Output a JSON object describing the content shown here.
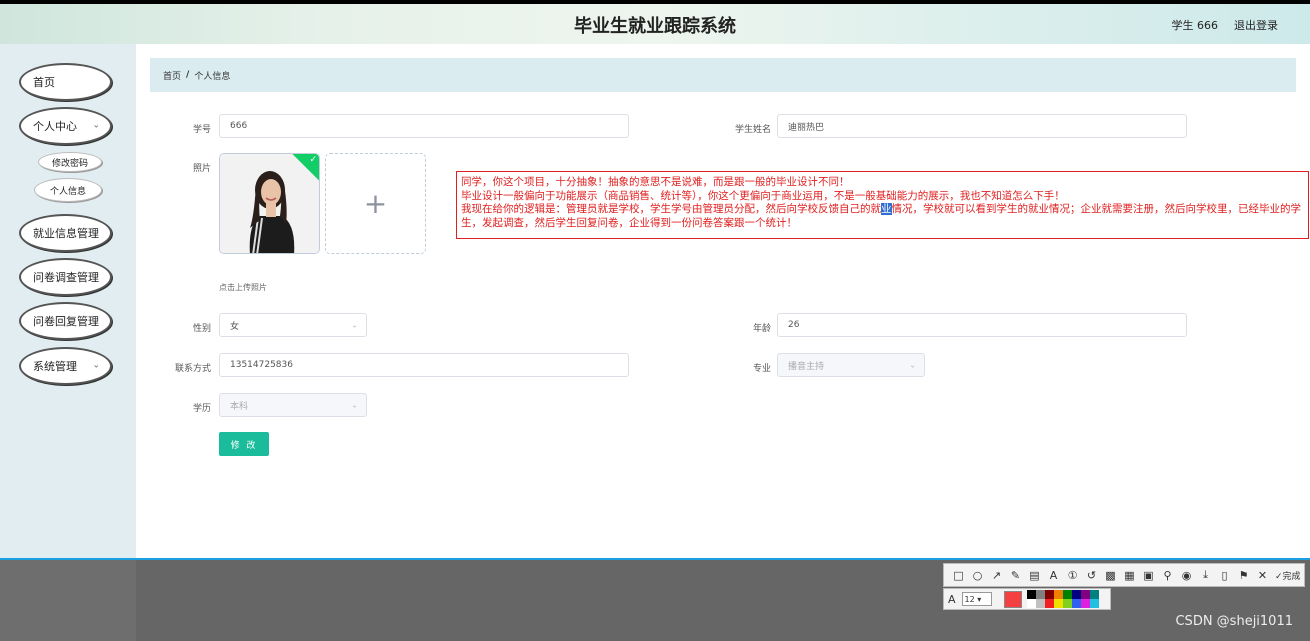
{
  "header": {
    "title": "毕业生就业跟踪系统",
    "user": "学生 666",
    "logout": "退出登录"
  },
  "sidebar": {
    "items": [
      {
        "label": "首页"
      },
      {
        "label": "个人中心"
      },
      {
        "label": "就业信息管理"
      },
      {
        "label": "问卷调查管理"
      },
      {
        "label": "问卷回复管理"
      },
      {
        "label": "系统管理"
      }
    ],
    "sub": [
      {
        "label": "修改密码"
      },
      {
        "label": "个人信息"
      }
    ]
  },
  "breadcrumb": {
    "home": "首页",
    "sep": "/",
    "current": "个人信息"
  },
  "form": {
    "student_no_label": "学号",
    "student_no": "666",
    "student_name_label": "学生姓名",
    "student_name": "迪丽热巴",
    "photo_label": "照片",
    "upload_hint": "点击上传照片",
    "gender_label": "性别",
    "gender": "女",
    "age_label": "年龄",
    "age": "26",
    "contact_label": "联系方式",
    "contact": "13514725836",
    "major_label": "专业",
    "major": "播音主持",
    "education_label": "学历",
    "education": "本科",
    "submit": "修 改"
  },
  "note": {
    "line1": "同学，你这个项目，十分抽象！抽象的意思不是说难，而是跟一般的毕业设计不同！",
    "line2": "毕业设计一般偏向于功能展示（商品销售、统计等），你这个更偏向于商业运用，不是一般基础能力的展示，我也不知道怎么下手！",
    "line3a": "我现在给你的逻辑是：管理员就是学校，学生学号由管理员分配，然后向学校反馈自己的就",
    "line3hl": "业",
    "line3b": "情况，学校就可以看到学生的就业情况；企业就需要注册，然后向学校里，已经毕业的学生，发起调查，然后学生回复问卷，企业得到一份问卷答案跟一个统计！"
  },
  "toolbar": {
    "done": "完成",
    "font_size": "12"
  },
  "watermark": "CSDN @sheji1011",
  "colors": {
    "accent": "#1abc9c",
    "sidebar_bg": "#e1edf0",
    "breadcrumb_bg": "#dbecf0",
    "note": "#e02020"
  }
}
